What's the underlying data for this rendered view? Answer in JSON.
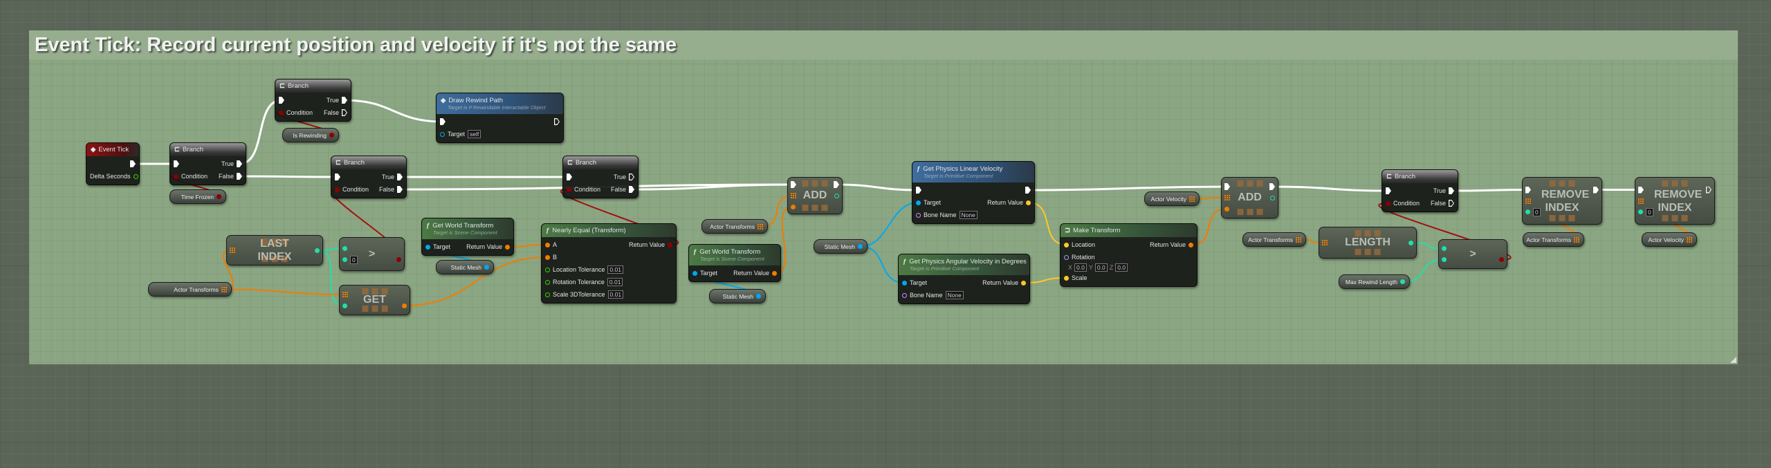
{
  "comment": {
    "title": "Event Tick: Record current position and velocity if it's not the same",
    "color": "#96ae8e"
  },
  "pin_colors": {
    "exec": "#ffffff",
    "bool": "#8c0000",
    "object": "#00a8f0",
    "struct": "#f07c00",
    "float": "#38d500",
    "int": "#1fe0a8",
    "vector": "#fdc82a",
    "rotator": "#9a9cff",
    "name": "#c88cff",
    "array": "#f07c00"
  },
  "nodes": [
    {
      "id": "tick",
      "kind": "node",
      "style": "event",
      "icon": "event-diamond-icon",
      "title": "Event Tick",
      "rows": [
        {
          "out": {
            "type": "exec"
          }
        },
        {
          "out": {
            "type": "float",
            "label": "Delta Seconds",
            "hollow": true
          }
        }
      ]
    },
    {
      "id": "br1",
      "kind": "node",
      "style": "branch",
      "icon": "branch-icon",
      "title": "Branch",
      "rows": [
        {
          "in": {
            "type": "exec"
          },
          "out": {
            "type": "exec",
            "label": "True"
          }
        },
        {
          "in": {
            "type": "bool",
            "label": "Condition"
          },
          "out": {
            "type": "exec",
            "label": "False"
          }
        }
      ]
    },
    {
      "id": "timefrozen",
      "kind": "var",
      "label": "Time Frozen",
      "type": "bool"
    },
    {
      "id": "br2",
      "kind": "node",
      "style": "branch",
      "icon": "branch-icon",
      "title": "Branch",
      "rows": [
        {
          "in": {
            "type": "exec"
          },
          "out": {
            "type": "exec",
            "label": "True"
          }
        },
        {
          "in": {
            "type": "bool",
            "label": "Condition"
          },
          "out": {
            "type": "exec",
            "label": "False",
            "hollow": true
          }
        }
      ]
    },
    {
      "id": "isrew",
      "kind": "var",
      "label": "Is Rewinding",
      "type": "bool"
    },
    {
      "id": "draw",
      "kind": "node",
      "style": "blue",
      "icon": "event-diamond-icon",
      "title": "Draw Rewind Path",
      "subtitle": "Target is P Rewindable Interactable Object",
      "rows": [
        {
          "in": {
            "type": "exec"
          },
          "out": {
            "type": "exec",
            "hollow": true
          }
        },
        {
          "in": {
            "type": "object",
            "label": "Target",
            "default": "self",
            "hollow": true
          }
        }
      ]
    },
    {
      "id": "br3",
      "kind": "node",
      "style": "branch",
      "icon": "branch-icon",
      "title": "Branch",
      "rows": [
        {
          "in": {
            "type": "exec"
          },
          "out": {
            "type": "exec",
            "label": "True"
          }
        },
        {
          "in": {
            "type": "bool",
            "label": "Condition"
          },
          "out": {
            "type": "exec",
            "label": "False"
          }
        }
      ]
    },
    {
      "id": "br4",
      "kind": "node",
      "style": "branch",
      "icon": "branch-icon",
      "title": "Branch",
      "rows": [
        {
          "in": {
            "type": "exec"
          },
          "out": {
            "type": "exec",
            "label": "True",
            "hollow": true
          }
        },
        {
          "in": {
            "type": "bool",
            "label": "Condition"
          },
          "out": {
            "type": "exec",
            "label": "False"
          }
        }
      ]
    },
    {
      "id": "lastidx",
      "kind": "compact",
      "label": "LAST INDEX",
      "rows": [
        {
          "in": {
            "type": "array"
          },
          "out": {
            "type": "int"
          }
        }
      ]
    },
    {
      "id": "cmp1",
      "kind": "compact",
      "label": ">",
      "rows": [
        {
          "in": {
            "type": "int"
          }
        },
        {
          "in": {
            "type": "int",
            "default": "0"
          },
          "out": {
            "type": "bool"
          }
        }
      ]
    },
    {
      "id": "get",
      "kind": "compact",
      "label": "GET",
      "rows": [
        {
          "in": {
            "type": "array"
          }
        },
        {
          "in": {
            "type": "int"
          },
          "out": {
            "type": "struct"
          }
        }
      ]
    },
    {
      "id": "at1",
      "kind": "var",
      "label": "Actor Transforms",
      "type": "array"
    },
    {
      "id": "gwt1",
      "kind": "node",
      "style": "green",
      "icon": "function-icon",
      "title": "Get World Transform",
      "subtitle": "Target is Scene Component",
      "rows": [
        {
          "in": {
            "type": "object",
            "label": "Target"
          },
          "out": {
            "type": "struct",
            "label": "Return Value"
          }
        }
      ]
    },
    {
      "id": "sm1",
      "kind": "var",
      "label": "Static Mesh",
      "type": "object"
    },
    {
      "id": "ne",
      "kind": "node",
      "style": "green",
      "icon": "function-icon",
      "title": "Nearly Equal (Transform)",
      "rows": [
        {
          "in": {
            "type": "struct",
            "label": "A"
          },
          "out": {
            "type": "bool",
            "label": "Return Value"
          }
        },
        {
          "in": {
            "type": "struct",
            "label": "B"
          }
        },
        {
          "in": {
            "type": "float",
            "label": "Location Tolerance",
            "default": "0.01",
            "hollow": true
          }
        },
        {
          "in": {
            "type": "float",
            "label": "Rotation Tolerance",
            "default": "0.01",
            "hollow": true
          }
        },
        {
          "in": {
            "type": "float",
            "label": "Scale 3DTolerance",
            "default": "0.01",
            "hollow": true
          }
        }
      ]
    },
    {
      "id": "at2",
      "kind": "var",
      "label": "Actor Transforms",
      "type": "array"
    },
    {
      "id": "gwt2",
      "kind": "node",
      "style": "green",
      "icon": "function-icon",
      "title": "Get World Transform",
      "subtitle": "Target is Scene Component",
      "rows": [
        {
          "in": {
            "type": "object",
            "label": "Target"
          },
          "out": {
            "type": "struct",
            "label": "Return Value"
          }
        }
      ]
    },
    {
      "id": "sm2",
      "kind": "var",
      "label": "Static Mesh",
      "type": "object"
    },
    {
      "id": "add1",
      "kind": "compact",
      "label": "ADD",
      "rows": [
        {
          "in": {
            "type": "exec"
          },
          "out": {
            "type": "exec"
          }
        },
        {
          "in": {
            "type": "array"
          },
          "out": {
            "type": "int",
            "hollow": true
          }
        },
        {
          "in": {
            "type": "struct"
          }
        }
      ]
    },
    {
      "id": "sm3",
      "kind": "var",
      "label": "Static Mesh",
      "type": "object"
    },
    {
      "id": "linvel",
      "kind": "node",
      "style": "blue",
      "icon": "function-icon",
      "title": "Get Physics Linear Velocity",
      "subtitle": "Target is Primitive Component",
      "rows": [
        {
          "in": {
            "type": "exec"
          },
          "out": {
            "type": "exec"
          }
        },
        {
          "in": {
            "type": "object",
            "label": "Target"
          },
          "out": {
            "type": "vector",
            "label": "Return Value"
          }
        },
        {
          "in": {
            "type": "name",
            "label": "Bone Name",
            "default": "None",
            "hollow": true
          }
        }
      ]
    },
    {
      "id": "angvel",
      "kind": "node",
      "style": "green",
      "icon": "function-icon",
      "title": "Get Physics Angular Velocity in Degrees",
      "subtitle": "Target is Primitive Component",
      "rows": [
        {
          "in": {
            "type": "object",
            "label": "Target"
          },
          "out": {
            "type": "vector",
            "label": "Return Value"
          }
        },
        {
          "in": {
            "type": "name",
            "label": "Bone Name",
            "default": "None",
            "hollow": true
          }
        }
      ]
    },
    {
      "id": "make",
      "kind": "node",
      "style": "green",
      "icon": "make-struct-icon",
      "title": "Make Transform",
      "rows": [
        {
          "in": {
            "type": "vector",
            "label": "Location"
          },
          "out": {
            "type": "struct",
            "label": "Return Value"
          }
        },
        {
          "in": {
            "type": "rotator",
            "label": "Rotation",
            "hollow": true,
            "vector": {
              "X": "0.0",
              "Y": "0.0",
              "Z": "0.0"
            }
          }
        },
        {
          "in": {
            "type": "vector",
            "label": "Scale"
          }
        }
      ]
    },
    {
      "id": "av1",
      "kind": "var",
      "label": "Actor Velocity",
      "type": "array"
    },
    {
      "id": "add2",
      "kind": "compact",
      "label": "ADD",
      "rows": [
        {
          "in": {
            "type": "exec"
          },
          "out": {
            "type": "exec"
          }
        },
        {
          "in": {
            "type": "array"
          },
          "out": {
            "type": "int",
            "hollow": true
          }
        },
        {
          "in": {
            "type": "struct"
          }
        }
      ]
    },
    {
      "id": "at3",
      "kind": "var",
      "label": "Actor Transforms",
      "type": "array"
    },
    {
      "id": "length",
      "kind": "compact",
      "label": "LENGTH",
      "rows": [
        {
          "in": {
            "type": "array"
          },
          "out": {
            "type": "int"
          }
        }
      ]
    },
    {
      "id": "cmp2",
      "kind": "compact",
      "label": ">",
      "rows": [
        {
          "in": {
            "type": "int"
          }
        },
        {
          "in": {
            "type": "int"
          },
          "out": {
            "type": "bool"
          }
        }
      ]
    },
    {
      "id": "maxlen",
      "kind": "var",
      "label": "Max Rewind Length",
      "type": "int"
    },
    {
      "id": "br5",
      "kind": "node",
      "style": "branch",
      "icon": "branch-icon",
      "title": "Branch",
      "rows": [
        {
          "in": {
            "type": "exec"
          },
          "out": {
            "type": "exec",
            "label": "True"
          }
        },
        {
          "in": {
            "type": "bool",
            "label": "Condition"
          },
          "out": {
            "type": "exec",
            "label": "False",
            "hollow": true
          }
        }
      ]
    },
    {
      "id": "rem1",
      "kind": "compact",
      "label": "REMOVE INDEX",
      "rows": [
        {
          "in": {
            "type": "exec"
          },
          "out": {
            "type": "exec"
          }
        },
        {
          "in": {
            "type": "array"
          }
        },
        {
          "in": {
            "type": "int",
            "default": "0"
          }
        }
      ]
    },
    {
      "id": "at4",
      "kind": "var",
      "label": "Actor Transforms",
      "type": "array"
    },
    {
      "id": "rem2",
      "kind": "compact",
      "label": "REMOVE INDEX",
      "rows": [
        {
          "in": {
            "type": "exec"
          },
          "out": {
            "type": "exec",
            "hollow": true
          }
        },
        {
          "in": {
            "type": "array"
          }
        },
        {
          "in": {
            "type": "int",
            "default": "0"
          }
        }
      ]
    },
    {
      "id": "av2",
      "kind": "var",
      "label": "Actor Velocity",
      "type": "array"
    }
  ]
}
